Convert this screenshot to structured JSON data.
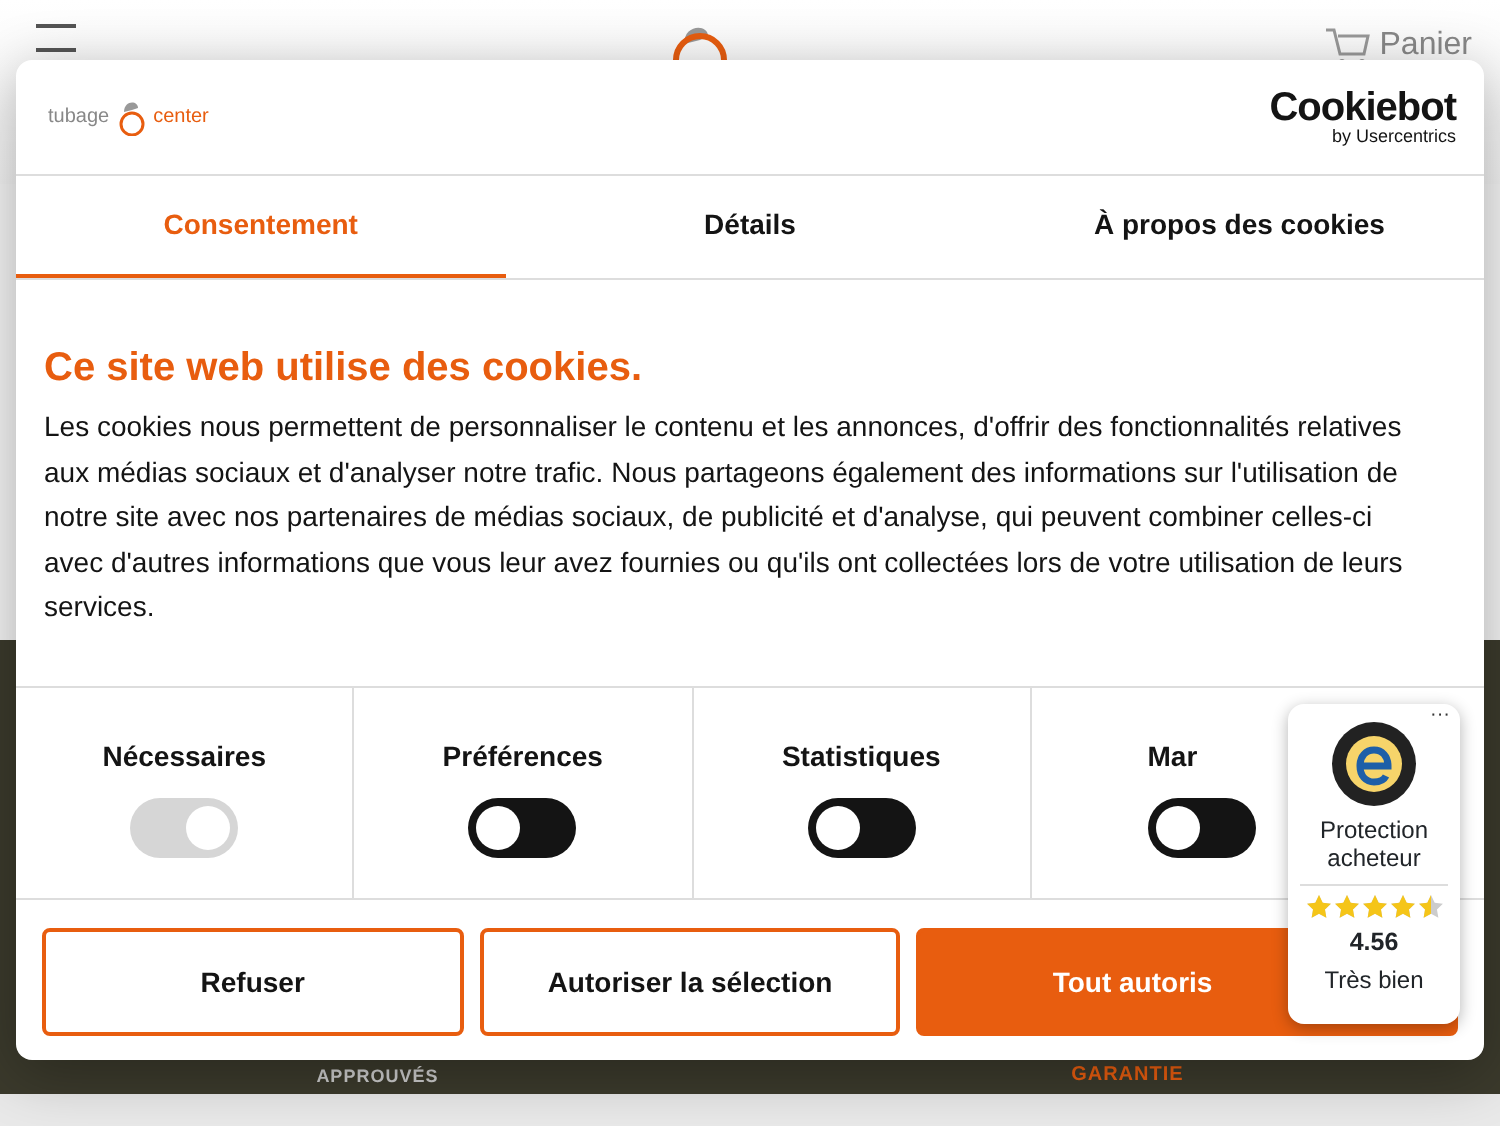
{
  "page": {
    "cart_label": "Panier",
    "footer_badges": [
      "APPROUVÉS",
      "GARANTIE"
    ]
  },
  "dialog": {
    "logo": {
      "left": "tubage",
      "right": "center"
    },
    "provider": {
      "name": "Cookiebot",
      "byline": "by Usercentrics"
    },
    "tabs": [
      {
        "label": "Consentement",
        "selected": true
      },
      {
        "label": "Détails",
        "selected": false
      },
      {
        "label": "À propos des cookies",
        "selected": false
      }
    ],
    "heading": "Ce site web utilise des cookies.",
    "body": "Les cookies nous permettent de personnaliser le contenu et les annonces, d'offrir des fonctionnalités relatives aux médias sociaux et d'analyser notre trafic. Nous partageons également des informations sur l'utilisation de notre site avec nos partenaires de médias sociaux, de publicité et d'analyse, qui peuvent combiner celles-ci avec d'autres informations que vous leur avez fournies ou qu'ils ont collectées lors de votre utilisation de leurs services.",
    "categories": [
      {
        "label": "Nécessaires",
        "on": true,
        "disabled": true
      },
      {
        "label": "Préférences",
        "on": false,
        "disabled": false
      },
      {
        "label": "Statistiques",
        "on": false,
        "disabled": false
      },
      {
        "label": "Mar",
        "on": false,
        "disabled": false
      }
    ],
    "buttons": [
      {
        "label": "Refuser",
        "kind": "outline"
      },
      {
        "label": "Autoriser la sélection",
        "kind": "outline"
      },
      {
        "label": "Tout autoris",
        "kind": "primary"
      }
    ]
  },
  "trust_badge": {
    "title": "Protection acheteur",
    "stars": 4.5,
    "score": "4.56",
    "rating": "Très bien",
    "menu": "···"
  }
}
